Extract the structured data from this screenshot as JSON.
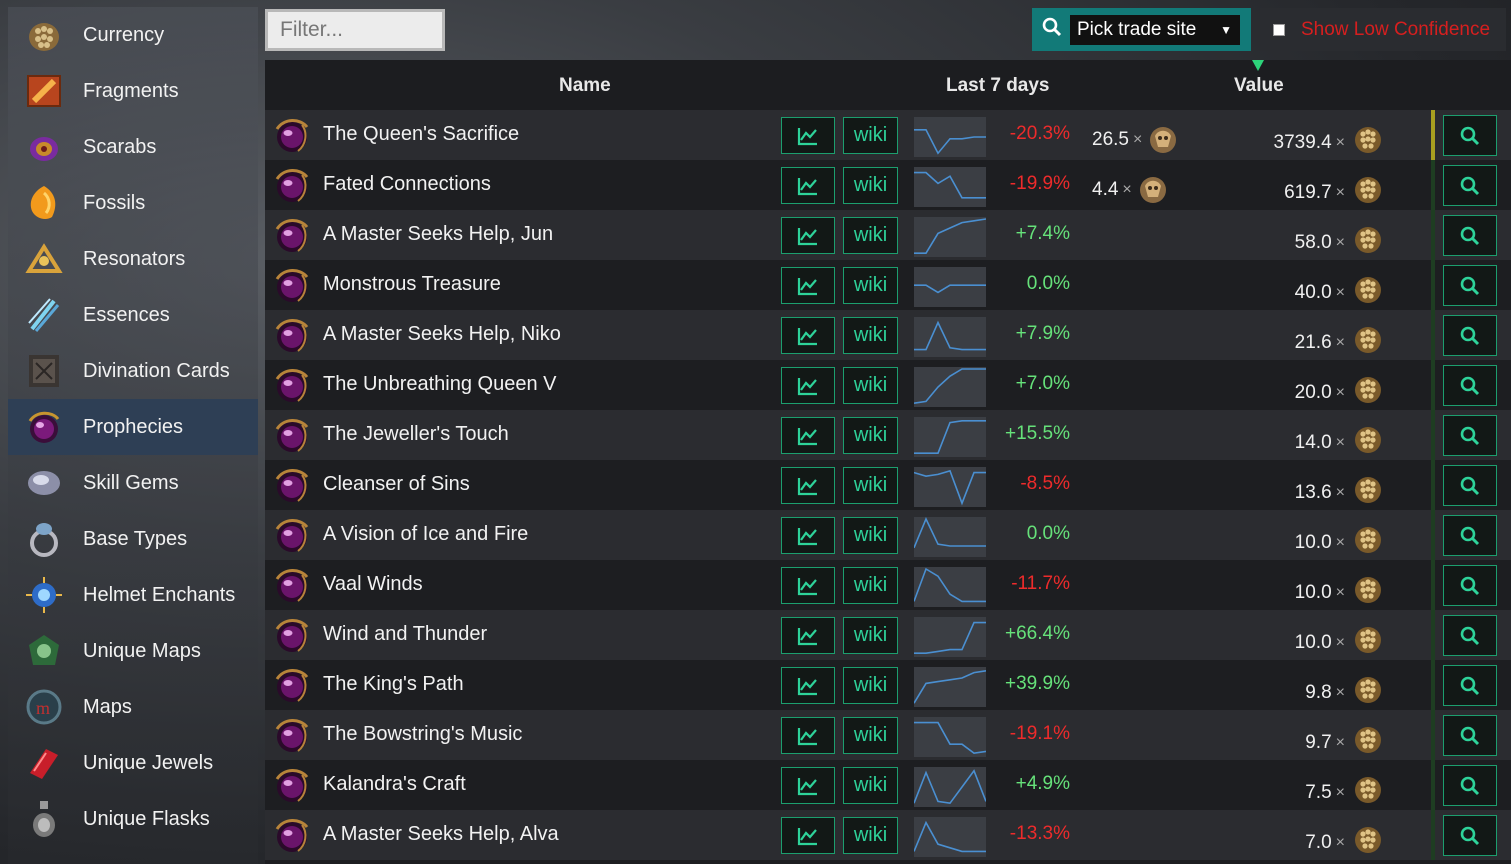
{
  "sidebar": {
    "items": [
      {
        "label": "Currency",
        "icon": "currency-icon",
        "active": false
      },
      {
        "label": "Fragments",
        "icon": "fragments-icon",
        "active": false
      },
      {
        "label": "Scarabs",
        "icon": "scarabs-icon",
        "active": false
      },
      {
        "label": "Fossils",
        "icon": "fossils-icon",
        "active": false
      },
      {
        "label": "Resonators",
        "icon": "resonators-icon",
        "active": false
      },
      {
        "label": "Essences",
        "icon": "essences-icon",
        "active": false
      },
      {
        "label": "Divination Cards",
        "icon": "divination-cards-icon",
        "active": false
      },
      {
        "label": "Prophecies",
        "icon": "prophecies-icon",
        "active": true
      },
      {
        "label": "Skill Gems",
        "icon": "skill-gems-icon",
        "active": false
      },
      {
        "label": "Base Types",
        "icon": "base-types-icon",
        "active": false
      },
      {
        "label": "Helmet Enchants",
        "icon": "helmet-enchants-icon",
        "active": false
      },
      {
        "label": "Unique Maps",
        "icon": "unique-maps-icon",
        "active": false
      },
      {
        "label": "Maps",
        "icon": "maps-icon",
        "active": false
      },
      {
        "label": "Unique Jewels",
        "icon": "unique-jewels-icon",
        "active": false
      },
      {
        "label": "Unique Flasks",
        "icon": "unique-flasks-icon",
        "active": false
      }
    ]
  },
  "toolbar": {
    "filter_placeholder": "Filter...",
    "trade_site_label": "Pick trade site",
    "low_confidence_label": "Show Low Confidence"
  },
  "table": {
    "headers": {
      "name": "Name",
      "last7": "Last 7 days",
      "value": "Value"
    },
    "wiki_label": "wiki",
    "times_symbol": "×",
    "rows": [
      {
        "name": "The Queen's Sacrifice",
        "change": "-20.3%",
        "trend": "neg",
        "exalt": "26.5",
        "value": "3739.4",
        "spark": [
          0.3,
          0.3,
          0.95,
          0.55,
          0.55,
          0.5,
          0.5
        ],
        "conf": "#a8a020"
      },
      {
        "name": "Fated Connections",
        "change": "-19.9%",
        "trend": "neg",
        "exalt": "4.4",
        "value": "619.7",
        "spark": [
          0.1,
          0.1,
          0.4,
          0.2,
          0.8,
          0.8,
          0.8
        ],
        "conf": "#1e3d22"
      },
      {
        "name": "A Master Seeks Help, Jun",
        "change": "+7.4%",
        "trend": "pos",
        "exalt": "",
        "value": "58.0",
        "spark": [
          0.95,
          0.95,
          0.4,
          0.25,
          0.1,
          0.05,
          0.0
        ],
        "conf": "#1e3d22"
      },
      {
        "name": "Monstrous Treasure",
        "change": "0.0%",
        "trend": "neu",
        "exalt": "",
        "value": "40.0",
        "spark": [
          0.45,
          0.45,
          0.65,
          0.45,
          0.45,
          0.45,
          0.45
        ],
        "conf": "#1e3d22"
      },
      {
        "name": "A Master Seeks Help, Niko",
        "change": "+7.9%",
        "trend": "pos",
        "exalt": "",
        "value": "21.6",
        "spark": [
          0.85,
          0.85,
          0.1,
          0.8,
          0.85,
          0.85,
          0.85
        ],
        "conf": "#1e3d22"
      },
      {
        "name": "The Unbreathing Queen V",
        "change": "+7.0%",
        "trend": "pos",
        "exalt": "",
        "value": "20.0",
        "spark": [
          0.95,
          0.9,
          0.5,
          0.2,
          0.0,
          0.0,
          0.0
        ],
        "conf": "#1e3d22"
      },
      {
        "name": "The Jeweller's Touch",
        "change": "+15.5%",
        "trend": "pos",
        "exalt": "",
        "value": "14.0",
        "spark": [
          0.95,
          0.95,
          0.95,
          0.1,
          0.05,
          0.05,
          0.05
        ],
        "conf": "#1e3d22"
      },
      {
        "name": "Cleanser of Sins",
        "change": "-8.5%",
        "trend": "neg",
        "exalt": "",
        "value": "13.6",
        "spark": [
          0.1,
          0.2,
          0.15,
          0.05,
          0.95,
          0.1,
          0.1
        ],
        "conf": "#1e3d22"
      },
      {
        "name": "A Vision of Ice and Fire",
        "change": "0.0%",
        "trend": "neu",
        "exalt": "",
        "value": "10.0",
        "spark": [
          0.8,
          0.0,
          0.7,
          0.75,
          0.75,
          0.75,
          0.75
        ],
        "conf": "#1e3d22"
      },
      {
        "name": "Vaal Winds",
        "change": "-11.7%",
        "trend": "neg",
        "exalt": "",
        "value": "10.0",
        "spark": [
          0.9,
          0.0,
          0.2,
          0.7,
          0.9,
          0.9,
          0.9
        ],
        "conf": "#1e3d22"
      },
      {
        "name": "Wind and Thunder",
        "change": "+66.4%",
        "trend": "pos",
        "exalt": "",
        "value": "10.0",
        "spark": [
          0.95,
          0.95,
          0.9,
          0.85,
          0.85,
          0.1,
          0.1
        ],
        "conf": "#1e3d22"
      },
      {
        "name": "The King's Path",
        "change": "+39.9%",
        "trend": "pos",
        "exalt": "",
        "value": "9.8",
        "spark": [
          0.95,
          0.4,
          0.35,
          0.3,
          0.25,
          0.1,
          0.05
        ],
        "conf": "#1e3d22"
      },
      {
        "name": "The Bowstring's Music",
        "change": "-19.1%",
        "trend": "neg",
        "exalt": "",
        "value": "9.7",
        "spark": [
          0.1,
          0.1,
          0.1,
          0.7,
          0.7,
          0.95,
          0.9
        ],
        "conf": "#1e3d22"
      },
      {
        "name": "Kalandra's Craft",
        "change": "+4.9%",
        "trend": "pos",
        "exalt": "",
        "value": "7.5",
        "spark": [
          0.95,
          0.1,
          0.9,
          0.95,
          0.5,
          0.05,
          0.9
        ],
        "conf": "#1e3d22"
      },
      {
        "name": "A Master Seeks Help, Alva",
        "change": "-13.3%",
        "trend": "neg",
        "exalt": "",
        "value": "7.0",
        "spark": [
          0.9,
          0.1,
          0.7,
          0.8,
          0.9,
          0.9,
          0.9
        ],
        "conf": "#1e3d22"
      }
    ]
  },
  "colors": {
    "positive": "#66e27a",
    "negative": "#ee2b2b",
    "accent": "#2ed39a",
    "sidebar_active": "#2e3f55",
    "spark_line": "#4a8fd1"
  }
}
